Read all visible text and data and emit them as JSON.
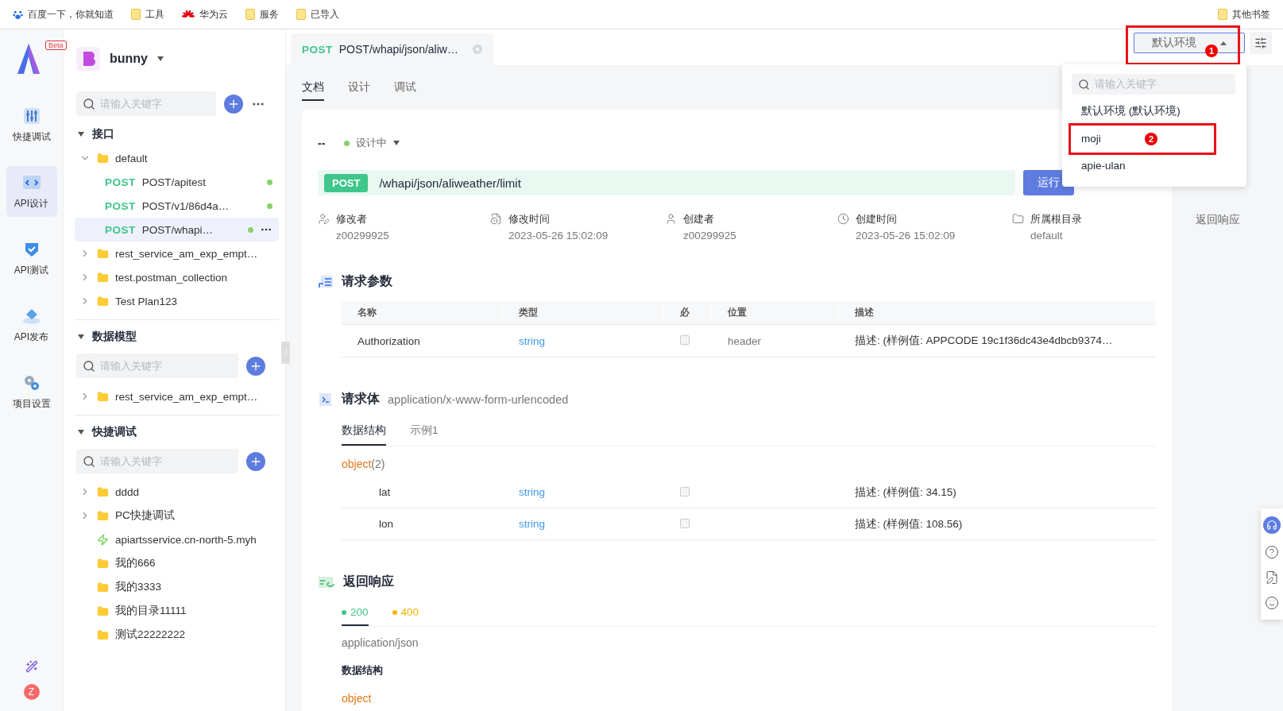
{
  "bookmarks": [
    {
      "label": "百度一下，你就知道",
      "kind": "paw"
    },
    {
      "label": "工具",
      "kind": "folder"
    },
    {
      "label": "华为云",
      "kind": "flower"
    },
    {
      "label": "服务",
      "kind": "folder"
    },
    {
      "label": "已导入",
      "kind": "folder"
    }
  ],
  "other_bookmarks": "其他书签",
  "nav": {
    "beta": "Beta",
    "items": [
      {
        "label": "快捷调试",
        "selected": false
      },
      {
        "label": "API设计",
        "selected": true
      },
      {
        "label": "API测试",
        "selected": false
      },
      {
        "label": "API发布",
        "selected": false
      },
      {
        "label": "项目设置",
        "selected": false
      }
    ],
    "avatar": "Z"
  },
  "project": {
    "name": "bunny"
  },
  "sections": [
    {
      "title": "接口",
      "expanded": true,
      "search_placeholder": "请输入关键字",
      "items": [
        {
          "kind": "folder",
          "label": "default",
          "expanded": true,
          "children": [
            {
              "kind": "endpoint",
              "method": "POST",
              "label": "POST/apitest",
              "selected": false
            },
            {
              "kind": "endpoint",
              "method": "POST",
              "label": "POST/v1/86d4a…",
              "selected": false
            },
            {
              "kind": "endpoint",
              "method": "POST",
              "label": "POST/whapi…",
              "selected": true
            }
          ]
        },
        {
          "kind": "folder",
          "label": "rest_service_am_exp_empt…",
          "expanded": false
        },
        {
          "kind": "folder",
          "label": "test.postman_collection",
          "expanded": false
        },
        {
          "kind": "folder",
          "label": "Test Plan123",
          "expanded": false
        }
      ]
    },
    {
      "title": "数据模型",
      "expanded": true,
      "search_placeholder": "请输入关键字",
      "items": [
        {
          "kind": "folder",
          "label": "rest_service_am_exp_empt…",
          "expanded": false
        }
      ]
    },
    {
      "title": "快捷调试",
      "expanded": true,
      "search_placeholder": "请输入关键字",
      "items": [
        {
          "kind": "folder",
          "label": "dddd",
          "expanded": false
        },
        {
          "kind": "folder",
          "label": "PC快捷调试",
          "expanded": false
        },
        {
          "kind": "link",
          "label": "apiartsservice.cn-north-5.myh"
        },
        {
          "kind": "leaf",
          "label": "我的666"
        },
        {
          "kind": "leaf",
          "label": "我的3333"
        },
        {
          "kind": "leaf",
          "label": "我的目录11111"
        },
        {
          "kind": "leaf",
          "label": "测试22222222"
        }
      ]
    }
  ],
  "doc_tab": {
    "method": "POST",
    "title": "POST/whapi/json/aliw…"
  },
  "page_tabs": [
    {
      "label": "文档",
      "selected": true
    },
    {
      "label": "设计",
      "selected": false
    },
    {
      "label": "调试",
      "selected": false
    }
  ],
  "api": {
    "name": "--",
    "status": "设计中",
    "method": "POST",
    "path": "/whapi/json/aliweather/limit",
    "run": "运行"
  },
  "meta": [
    {
      "kind": "user-edit",
      "label": "修改者",
      "value": "z00299925"
    },
    {
      "kind": "doc-clock",
      "label": "修改时间",
      "value": "2023-05-26 15:02:09"
    },
    {
      "kind": "user",
      "label": "创建者",
      "value": "z00299925"
    },
    {
      "kind": "clock",
      "label": "创建时间",
      "value": "2023-05-26 15:02:09"
    },
    {
      "kind": "folder",
      "label": "所属根目录",
      "value": "default"
    }
  ],
  "request_params": {
    "title": "请求参数",
    "columns": [
      "名称",
      "类型",
      "必",
      "位置",
      "描述"
    ],
    "rows": [
      {
        "name": "Authorization",
        "type": "string",
        "required": false,
        "location": "header",
        "description": "描述:  (样例值: APPCODE 19c1f36dc43e4dbcb9374…"
      }
    ]
  },
  "request_body": {
    "title": "请求体",
    "content_type": "application/x-www-form-urlencoded",
    "tabs": [
      {
        "label": "数据结构",
        "selected": true
      },
      {
        "label": "示例1",
        "selected": false
      }
    ],
    "object": "object",
    "count": "(2)",
    "rows": [
      {
        "name": "lat",
        "type": "string",
        "required": false,
        "description": "描述:  (样例值: 34.15)"
      },
      {
        "name": "lon",
        "type": "string",
        "required": false,
        "description": "描述:  (样例值: 108.56)"
      }
    ]
  },
  "response": {
    "title": "返回响应",
    "tabs": [
      {
        "label": "200",
        "selected": true,
        "color": "#3fc68a"
      },
      {
        "label": "400",
        "selected": false,
        "color": "#f5b400"
      }
    ],
    "content_type": "application/json",
    "structure": "数据结构",
    "object": "object"
  },
  "outline": [
    "返回响应"
  ],
  "env": {
    "value": "默认环境",
    "open": true,
    "marker": "1",
    "search_placeholder": "请输入关键字",
    "options": [
      {
        "label": "默认环境 (默认环境)"
      },
      {
        "label": "moji",
        "marker": "2"
      },
      {
        "label": "apie-ulan"
      }
    ]
  }
}
